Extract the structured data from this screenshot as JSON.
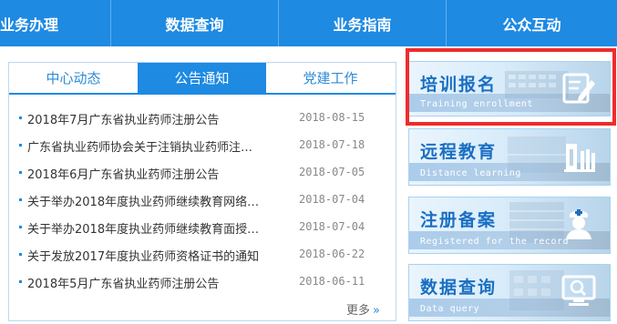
{
  "nav": {
    "items": [
      "业务办理",
      "数据查询",
      "业务指南",
      "公众互动"
    ]
  },
  "news_panel": {
    "tabs": [
      "中心动态",
      "公告通知",
      "党建工作"
    ],
    "active_tab": "公告通知",
    "items": [
      {
        "title": "2018年7月广东省执业药师注册公告",
        "date": "2018-08-15"
      },
      {
        "title": "广东省执业药师协会关于注销执业药师注…",
        "date": "2018-07-18"
      },
      {
        "title": "2018年6月广东省执业药师注册公告",
        "date": "2018-07-05"
      },
      {
        "title": "关于举办2018年度执业药师继续教育网络…",
        "date": "2018-07-04"
      },
      {
        "title": "关于举办2018年度执业药师继续教育面授…",
        "date": "2018-07-04"
      },
      {
        "title": "关于发放2017年度执业药师资格证书的通知",
        "date": "2018-06-22"
      },
      {
        "title": "2018年5月广东省执业药师注册公告",
        "date": "2018-06-11"
      }
    ],
    "more_label": "更多",
    "more_arrows": "»"
  },
  "banners": [
    {
      "title": "培训报名",
      "subtitle": "Training enrollment",
      "icon": "edit-icon"
    },
    {
      "title": "远程教育",
      "subtitle": "Distance learning",
      "icon": "books-icon"
    },
    {
      "title": "注册备案",
      "subtitle": "Registered for the record",
      "icon": "nurse-icon"
    },
    {
      "title": "数据查询",
      "subtitle": "Data query",
      "icon": "monitor-search-icon"
    }
  ],
  "colors": {
    "nav_bg": "#1e8ae2",
    "tab_active": "#1e8ae2",
    "banner_title": "#1a6fc2",
    "highlight_border": "#ef2b2b"
  }
}
